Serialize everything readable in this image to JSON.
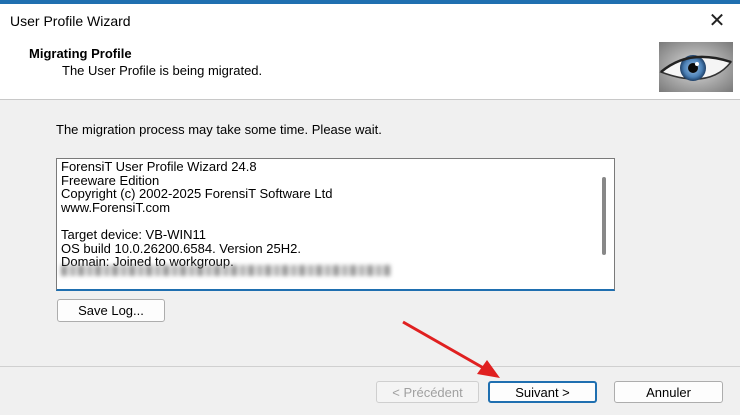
{
  "window": {
    "title": "User Profile Wizard",
    "close_icon": "close-icon"
  },
  "header": {
    "title": "Migrating Profile",
    "subtitle": "The User Profile is being migrated.",
    "image_icon": "eye-image"
  },
  "main": {
    "message": "The migration process may take some time. Please wait.",
    "log_lines": [
      "ForensiT User Profile Wizard 24.8",
      "Freeware Edition",
      "Copyright (c) 2002-2025 ForensiT Software Ltd",
      "www.ForensiT.com",
      "",
      "Target device: VB-WIN11",
      "OS build 10.0.26200.6584. Version 25H2.",
      "Domain: Joined to workgroup."
    ],
    "save_log_label": "Save Log..."
  },
  "footer": {
    "prev_label": "< Précédent",
    "next_label": "Suivant >",
    "cancel_label": "Annuler"
  },
  "colors": {
    "accent": "#1f6fb0",
    "annotation_arrow": "#e02020"
  }
}
